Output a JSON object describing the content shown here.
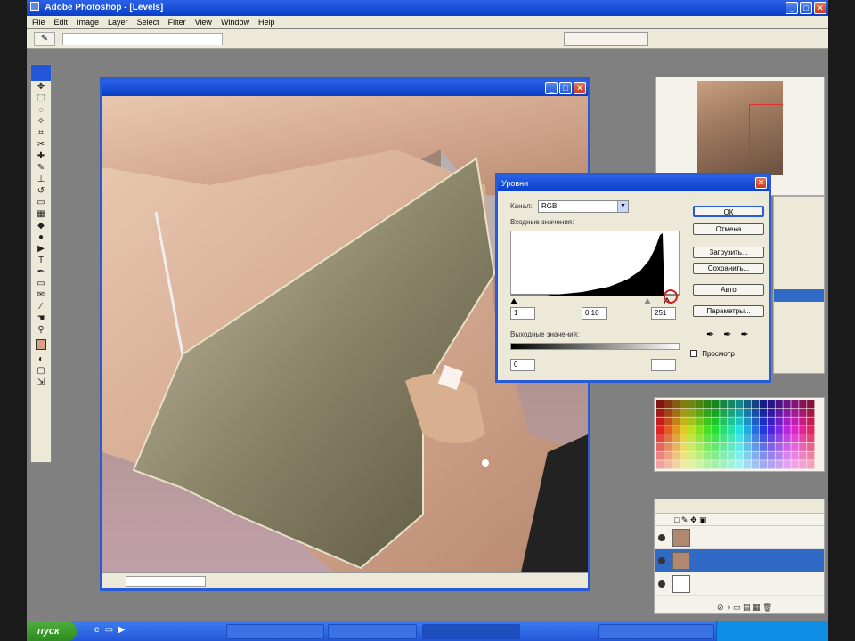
{
  "app": {
    "title": "Adobe Photoshop - [Levels]"
  },
  "menu": [
    "File",
    "Edit",
    "Image",
    "Layer",
    "Select",
    "Filter",
    "View",
    "Window",
    "Help"
  ],
  "options": {
    "field": "",
    "right": ""
  },
  "document": {
    "title": "",
    "status": ""
  },
  "levels": {
    "title": "Уровни",
    "channel_label": "Канал:",
    "channel_value": "RGB",
    "input_label": "Входные значения:",
    "input_black": "1",
    "input_gamma": "0,10",
    "input_white": "251",
    "output_label": "Выходные значения:",
    "output_black": "0",
    "output_white": "",
    "buttons": [
      "ОК",
      "Отмена",
      "Загрузить...",
      "Сохранить...",
      "Авто",
      "Параметры..."
    ],
    "preview_label": "Просмотр"
  },
  "layers": {
    "rows": [
      {
        "name": "",
        "active": false,
        "white": false
      },
      {
        "name": "",
        "active": true,
        "white": false
      },
      {
        "name": "",
        "active": false,
        "white": true
      }
    ]
  },
  "taskbar": {
    "start": "пуск",
    "items": [
      "",
      "",
      "",
      ""
    ]
  },
  "colors": {
    "accent": "#2a5bd7",
    "selection": "#316ac5"
  }
}
